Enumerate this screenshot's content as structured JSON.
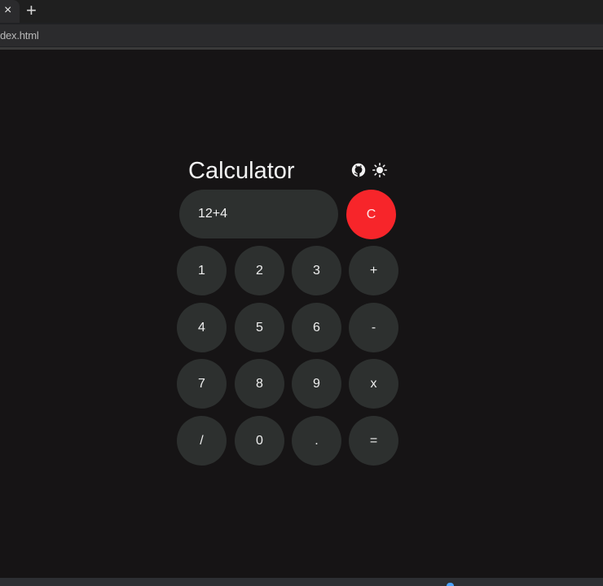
{
  "browser": {
    "tab_close": "×",
    "new_tab": "+",
    "address": "dex.html"
  },
  "calculator": {
    "title": "Calculator",
    "display_value": "12+4",
    "clear_label": "C",
    "icons": [
      "github-icon",
      "sun-icon"
    ],
    "keys": [
      [
        "1",
        "2",
        "3",
        "+"
      ],
      [
        "4",
        "5",
        "6",
        "-"
      ],
      [
        "7",
        "8",
        "9",
        "x"
      ],
      [
        "/",
        "0",
        ".",
        "="
      ]
    ],
    "colors": {
      "background": "#161415",
      "button": "#2d302f",
      "clear": "#f7252a"
    }
  }
}
